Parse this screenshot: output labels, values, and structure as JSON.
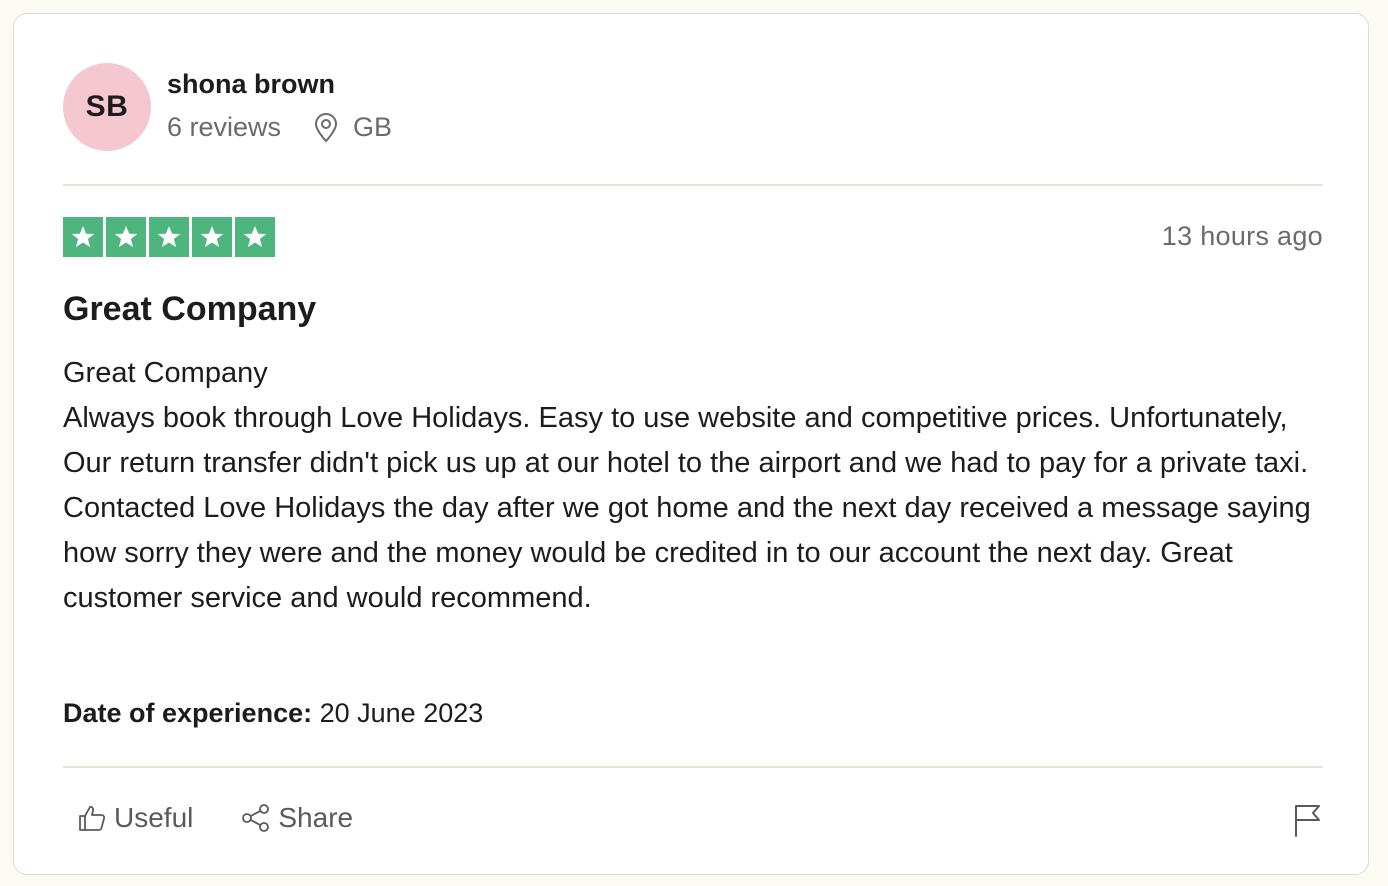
{
  "reviewer": {
    "initials": "SB",
    "name": "shona brown",
    "reviews_count": "6 reviews",
    "country": "GB",
    "location_icon": "map-pin-icon"
  },
  "review": {
    "rating": 5,
    "rating_max": 5,
    "time_ago": "13 hours ago",
    "title": "Great Company",
    "body_lines": [
      "Great Company",
      "Always book through Love Holidays. Easy to use website and competitive prices. Unfortunately, Our return transfer didn't pick us up at our hotel to the airport and we had to pay for a private taxi. Contacted Love Holidays the day after we got home and the next day received a message saying how sorry they were and the money would be credited in to our account the next day. Great customer service and would recommend."
    ],
    "experience_label": "Date of experience:",
    "experience_date": "20 June 2023"
  },
  "actions": {
    "useful_label": "Useful",
    "useful_icon": "thumbs-up-icon",
    "share_label": "Share",
    "share_icon": "share-icon",
    "flag_icon": "flag-icon"
  },
  "colors": {
    "star_green": "#4fb57f",
    "avatar_bg": "#f4c7d1",
    "muted_text": "#6b6b6b"
  }
}
